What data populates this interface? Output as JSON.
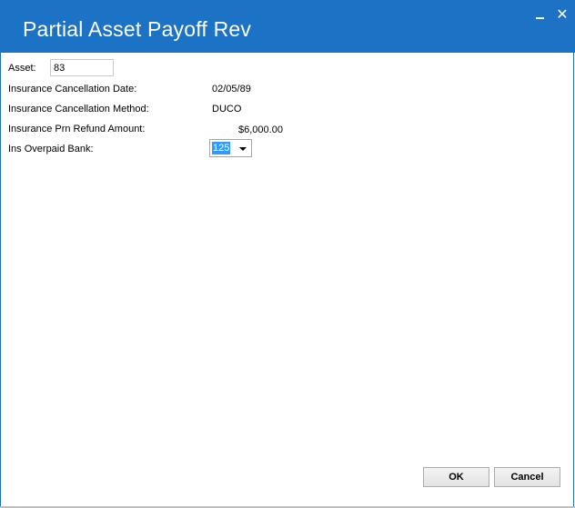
{
  "window": {
    "title": "Partial Asset Payoff Rev",
    "minimize_glyph": "",
    "close_glyph": "✕"
  },
  "form": {
    "asset_label": "Asset:",
    "asset_value": "83",
    "cancel_date_label": "Insurance Cancellation Date:",
    "cancel_date_value": "02/05/89",
    "cancel_method_label": "Insurance Cancellation Method:",
    "cancel_method_value": "DUCO",
    "refund_label": "Insurance Prn Refund Amount:",
    "refund_value": "$6,000.00",
    "bank_label": "Ins Overpaid Bank:",
    "bank_value": "125"
  },
  "buttons": {
    "ok_label": "OK",
    "cancel_label": "Cancel"
  },
  "colors": {
    "titlebar": "#1c73c6",
    "selection": "#3399ff"
  }
}
